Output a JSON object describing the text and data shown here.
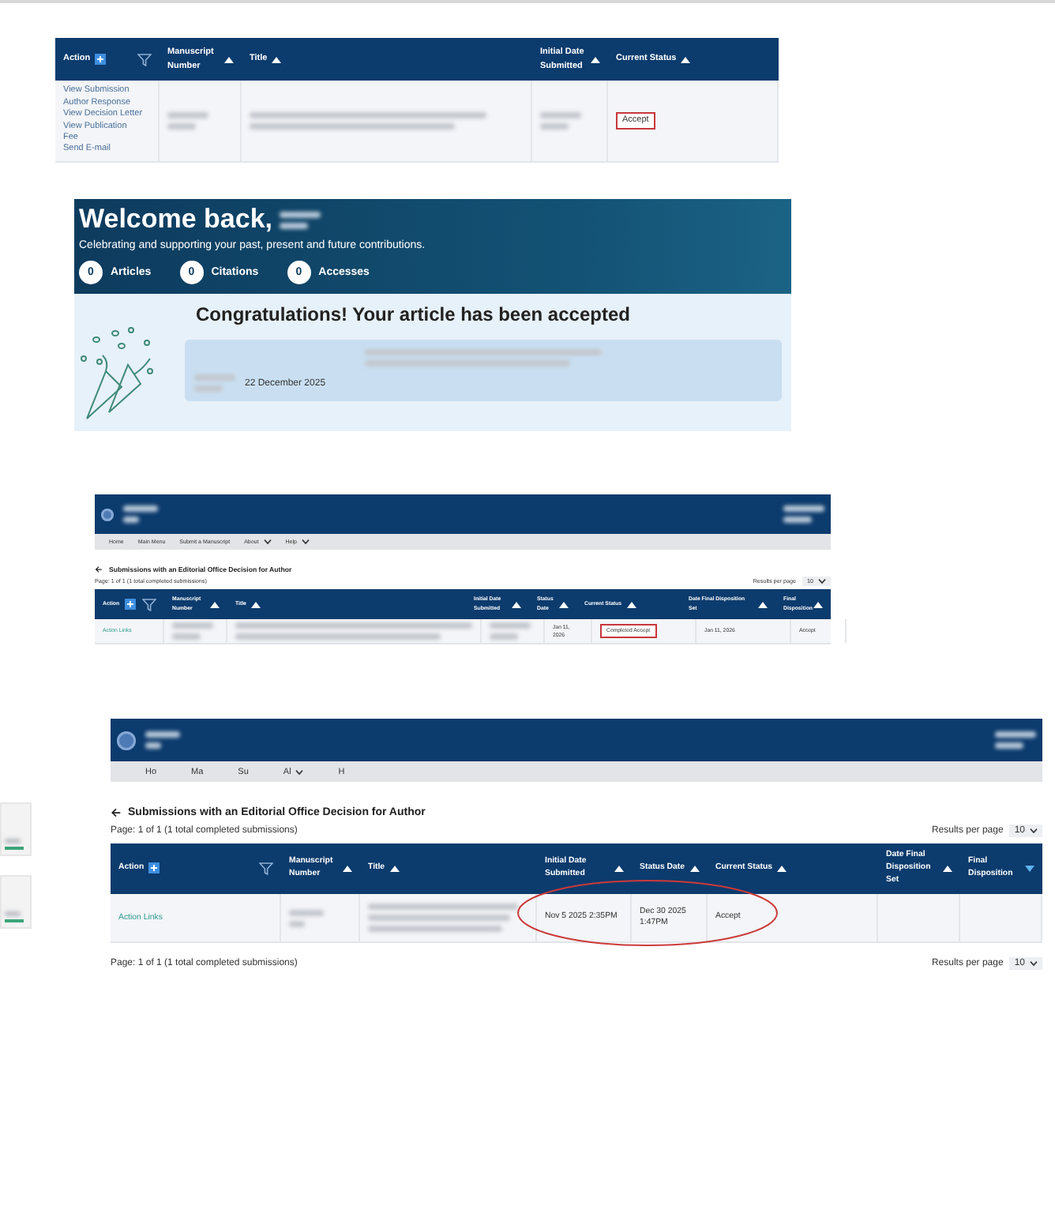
{
  "decision_table": {
    "columns": [
      {
        "kind": "action",
        "label": "Action"
      },
      {
        "kind": "sortable",
        "label": "Manuscript Number",
        "descending": false
      },
      {
        "kind": "sortable",
        "label": "Title",
        "descending": false
      },
      {
        "kind": "sortable",
        "label": "Initial Date Submitted",
        "descending": false
      },
      {
        "kind": "sortable",
        "label": "Current Status",
        "descending": false
      }
    ],
    "rows": [
      {
        "cells": [
          {
            "kind": "links",
            "items": [
              "View Submission",
              "Author Response",
              "View Decision Letter",
              "View Publication",
              "Fee",
              "Send E-mail"
            ]
          },
          {
            "kind": "blurred-short"
          },
          {
            "kind": "blurred-long"
          },
          {
            "kind": "blurred-short"
          },
          {
            "kind": "text",
            "text": "Accept",
            "highlighted": true
          }
        ]
      }
    ]
  },
  "welcome_banner": {
    "greeting": "Welcome back,",
    "tagline": "Celebrating and supporting your past, present and future contributions.",
    "stats": [
      {
        "count": "0",
        "label": "Articles"
      },
      {
        "count": "0",
        "label": "Citations"
      },
      {
        "count": "0",
        "label": "Accesses"
      }
    ],
    "congrats_heading": "Congratulations! Your article has been accepted",
    "article_date": "22 December 2025"
  },
  "side_cards": [
    {
      "kind": "card"
    },
    {
      "kind": "card"
    }
  ],
  "portals": [
    {
      "nav": [
        {
          "label": "Home",
          "dropdown": false
        },
        {
          "label": "Main Menu",
          "dropdown": false
        },
        {
          "label": "Submit a Manuscript",
          "dropdown": false
        },
        {
          "label": "About",
          "dropdown": true
        },
        {
          "label": "Help",
          "dropdown": true
        }
      ],
      "heading": "Submissions with an Editorial Office Decision for Author",
      "page_info": "Page: 1 of 1 (1 total completed submissions)",
      "results_label": "Results per page",
      "results_value": "10",
      "columns": [
        {
          "kind": "action",
          "label": "Action"
        },
        {
          "kind": "sortable",
          "label": "Manuscript Number",
          "descending": false
        },
        {
          "kind": "sortable",
          "label": "Title",
          "descending": false
        },
        {
          "kind": "sortable",
          "label": "Initial Date Submitted",
          "descending": false
        },
        {
          "kind": "sortable",
          "label": "Status Date",
          "descending": false
        },
        {
          "kind": "sortable",
          "label": "Current Status",
          "descending": false
        },
        {
          "kind": "sortable",
          "label": "Date Final Disposition Set",
          "descending": false
        },
        {
          "kind": "sortable",
          "label": "Final Disposition",
          "descending": false
        }
      ],
      "rows": [
        {
          "cells": [
            {
              "kind": "link",
              "text": "Action Links"
            },
            {
              "kind": "blurred-short"
            },
            {
              "kind": "blurred-long"
            },
            {
              "kind": "blurred-short"
            },
            {
              "kind": "text",
              "text": "Jan 11, 2026"
            },
            {
              "kind": "text",
              "text": "Completed Accept",
              "highlighted": true
            },
            {
              "kind": "text",
              "text": "Jan 11, 2026"
            },
            {
              "kind": "text",
              "text": "Accept"
            }
          ]
        }
      ]
    },
    {
      "nav": [
        {
          "label": "Ho",
          "dropdown": false
        },
        {
          "label": "Ma",
          "dropdown": false
        },
        {
          "label": "Su",
          "dropdown": false
        },
        {
          "label": "Al",
          "dropdown": true
        },
        {
          "label": "H",
          "dropdown": false
        }
      ],
      "heading": "Submissions with an Editorial Office Decision for Author",
      "page_info": "Page: 1 of 1 (1 total completed submissions)",
      "results_label": "Results per page",
      "results_value": "10",
      "columns": [
        {
          "kind": "action",
          "label": "Action"
        },
        {
          "kind": "sortable",
          "label": "Manuscript Number",
          "descending": false
        },
        {
          "kind": "sortable",
          "label": "Title",
          "descending": false
        },
        {
          "kind": "sortable",
          "label": "Initial Date Submitted",
          "descending": false
        },
        {
          "kind": "sortable",
          "label": "Status Date",
          "descending": false
        },
        {
          "kind": "sortable",
          "label": "Current Status",
          "descending": false
        },
        {
          "kind": "sortable",
          "label": "Date Final Disposition Set",
          "descending": false
        },
        {
          "kind": "sortable",
          "label": "Final Disposition",
          "descending": true
        }
      ],
      "rows": [
        {
          "cells": [
            {
              "kind": "link",
              "text": "Action Links"
            },
            {
              "kind": "blurred-two-line"
            },
            {
              "kind": "blurred-three-line"
            },
            {
              "kind": "text",
              "text": "Nov 5 2025 2:35PM"
            },
            {
              "kind": "text",
              "text": "Dec 30 2025 1:47PM"
            },
            {
              "kind": "text",
              "text": "Accept",
              "highlighted": false
            },
            {
              "kind": "empty"
            },
            {
              "kind": "empty"
            }
          ]
        }
      ],
      "footer": {
        "page_info": "Page: 1 of 1 (1 total completed submissions)",
        "results_label": "Results per page",
        "results_value": "10"
      },
      "annotation": {
        "kind": "ellipse"
      }
    }
  ]
}
